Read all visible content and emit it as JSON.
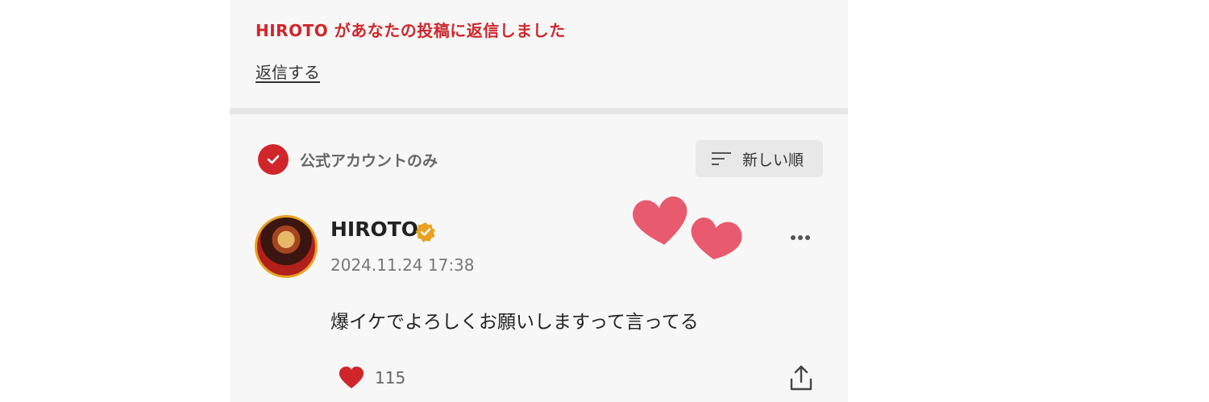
{
  "notification": {
    "text": "HIROTO があなたの投稿に返信しました",
    "reply_link": "返信する"
  },
  "filter": {
    "label": "公式アカウントのみ",
    "checked": true
  },
  "sort": {
    "label": "新しい順"
  },
  "post": {
    "username": "HIROTO",
    "verified": true,
    "timestamp": "2024.11.24 17:38",
    "text": "爆イケでよろしくお願いしますって言ってる",
    "like_count": "115"
  },
  "colors": {
    "accent": "#d0262b",
    "verified": "#e9a21f",
    "sticker_heart": "#e85a6e"
  },
  "icons": {
    "filter_check": "check-icon",
    "sort": "sort-lines-icon",
    "verified": "verified-badge-icon",
    "more": "more-dots-icon",
    "like": "heart-icon",
    "share": "share-icon",
    "sticker": "hearts-sticker"
  }
}
